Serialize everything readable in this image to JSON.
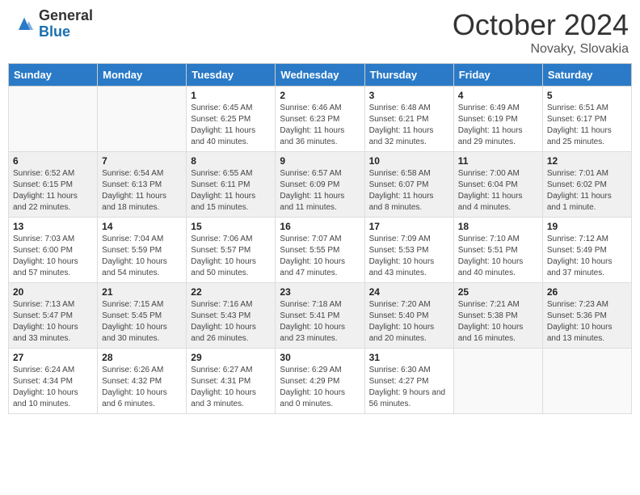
{
  "header": {
    "logo_general": "General",
    "logo_blue": "Blue",
    "month_year": "October 2024",
    "location": "Novaky, Slovakia"
  },
  "weekdays": [
    "Sunday",
    "Monday",
    "Tuesday",
    "Wednesday",
    "Thursday",
    "Friday",
    "Saturday"
  ],
  "weeks": [
    [
      {
        "day": "",
        "sunrise": "",
        "sunset": "",
        "daylight": "",
        "empty": true
      },
      {
        "day": "",
        "sunrise": "",
        "sunset": "",
        "daylight": "",
        "empty": true
      },
      {
        "day": "1",
        "sunrise": "Sunrise: 6:45 AM",
        "sunset": "Sunset: 6:25 PM",
        "daylight": "Daylight: 11 hours and 40 minutes."
      },
      {
        "day": "2",
        "sunrise": "Sunrise: 6:46 AM",
        "sunset": "Sunset: 6:23 PM",
        "daylight": "Daylight: 11 hours and 36 minutes."
      },
      {
        "day": "3",
        "sunrise": "Sunrise: 6:48 AM",
        "sunset": "Sunset: 6:21 PM",
        "daylight": "Daylight: 11 hours and 32 minutes."
      },
      {
        "day": "4",
        "sunrise": "Sunrise: 6:49 AM",
        "sunset": "Sunset: 6:19 PM",
        "daylight": "Daylight: 11 hours and 29 minutes."
      },
      {
        "day": "5",
        "sunrise": "Sunrise: 6:51 AM",
        "sunset": "Sunset: 6:17 PM",
        "daylight": "Daylight: 11 hours and 25 minutes."
      }
    ],
    [
      {
        "day": "6",
        "sunrise": "Sunrise: 6:52 AM",
        "sunset": "Sunset: 6:15 PM",
        "daylight": "Daylight: 11 hours and 22 minutes."
      },
      {
        "day": "7",
        "sunrise": "Sunrise: 6:54 AM",
        "sunset": "Sunset: 6:13 PM",
        "daylight": "Daylight: 11 hours and 18 minutes."
      },
      {
        "day": "8",
        "sunrise": "Sunrise: 6:55 AM",
        "sunset": "Sunset: 6:11 PM",
        "daylight": "Daylight: 11 hours and 15 minutes."
      },
      {
        "day": "9",
        "sunrise": "Sunrise: 6:57 AM",
        "sunset": "Sunset: 6:09 PM",
        "daylight": "Daylight: 11 hours and 11 minutes."
      },
      {
        "day": "10",
        "sunrise": "Sunrise: 6:58 AM",
        "sunset": "Sunset: 6:07 PM",
        "daylight": "Daylight: 11 hours and 8 minutes."
      },
      {
        "day": "11",
        "sunrise": "Sunrise: 7:00 AM",
        "sunset": "Sunset: 6:04 PM",
        "daylight": "Daylight: 11 hours and 4 minutes."
      },
      {
        "day": "12",
        "sunrise": "Sunrise: 7:01 AM",
        "sunset": "Sunset: 6:02 PM",
        "daylight": "Daylight: 11 hours and 1 minute."
      }
    ],
    [
      {
        "day": "13",
        "sunrise": "Sunrise: 7:03 AM",
        "sunset": "Sunset: 6:00 PM",
        "daylight": "Daylight: 10 hours and 57 minutes."
      },
      {
        "day": "14",
        "sunrise": "Sunrise: 7:04 AM",
        "sunset": "Sunset: 5:59 PM",
        "daylight": "Daylight: 10 hours and 54 minutes."
      },
      {
        "day": "15",
        "sunrise": "Sunrise: 7:06 AM",
        "sunset": "Sunset: 5:57 PM",
        "daylight": "Daylight: 10 hours and 50 minutes."
      },
      {
        "day": "16",
        "sunrise": "Sunrise: 7:07 AM",
        "sunset": "Sunset: 5:55 PM",
        "daylight": "Daylight: 10 hours and 47 minutes."
      },
      {
        "day": "17",
        "sunrise": "Sunrise: 7:09 AM",
        "sunset": "Sunset: 5:53 PM",
        "daylight": "Daylight: 10 hours and 43 minutes."
      },
      {
        "day": "18",
        "sunrise": "Sunrise: 7:10 AM",
        "sunset": "Sunset: 5:51 PM",
        "daylight": "Daylight: 10 hours and 40 minutes."
      },
      {
        "day": "19",
        "sunrise": "Sunrise: 7:12 AM",
        "sunset": "Sunset: 5:49 PM",
        "daylight": "Daylight: 10 hours and 37 minutes."
      }
    ],
    [
      {
        "day": "20",
        "sunrise": "Sunrise: 7:13 AM",
        "sunset": "Sunset: 5:47 PM",
        "daylight": "Daylight: 10 hours and 33 minutes."
      },
      {
        "day": "21",
        "sunrise": "Sunrise: 7:15 AM",
        "sunset": "Sunset: 5:45 PM",
        "daylight": "Daylight: 10 hours and 30 minutes."
      },
      {
        "day": "22",
        "sunrise": "Sunrise: 7:16 AM",
        "sunset": "Sunset: 5:43 PM",
        "daylight": "Daylight: 10 hours and 26 minutes."
      },
      {
        "day": "23",
        "sunrise": "Sunrise: 7:18 AM",
        "sunset": "Sunset: 5:41 PM",
        "daylight": "Daylight: 10 hours and 23 minutes."
      },
      {
        "day": "24",
        "sunrise": "Sunrise: 7:20 AM",
        "sunset": "Sunset: 5:40 PM",
        "daylight": "Daylight: 10 hours and 20 minutes."
      },
      {
        "day": "25",
        "sunrise": "Sunrise: 7:21 AM",
        "sunset": "Sunset: 5:38 PM",
        "daylight": "Daylight: 10 hours and 16 minutes."
      },
      {
        "day": "26",
        "sunrise": "Sunrise: 7:23 AM",
        "sunset": "Sunset: 5:36 PM",
        "daylight": "Daylight: 10 hours and 13 minutes."
      }
    ],
    [
      {
        "day": "27",
        "sunrise": "Sunrise: 6:24 AM",
        "sunset": "Sunset: 4:34 PM",
        "daylight": "Daylight: 10 hours and 10 minutes."
      },
      {
        "day": "28",
        "sunrise": "Sunrise: 6:26 AM",
        "sunset": "Sunset: 4:32 PM",
        "daylight": "Daylight: 10 hours and 6 minutes."
      },
      {
        "day": "29",
        "sunrise": "Sunrise: 6:27 AM",
        "sunset": "Sunset: 4:31 PM",
        "daylight": "Daylight: 10 hours and 3 minutes."
      },
      {
        "day": "30",
        "sunrise": "Sunrise: 6:29 AM",
        "sunset": "Sunset: 4:29 PM",
        "daylight": "Daylight: 10 hours and 0 minutes."
      },
      {
        "day": "31",
        "sunrise": "Sunrise: 6:30 AM",
        "sunset": "Sunset: 4:27 PM",
        "daylight": "Daylight: 9 hours and 56 minutes."
      },
      {
        "day": "",
        "sunrise": "",
        "sunset": "",
        "daylight": "",
        "empty": true
      },
      {
        "day": "",
        "sunrise": "",
        "sunset": "",
        "daylight": "",
        "empty": true
      }
    ]
  ]
}
